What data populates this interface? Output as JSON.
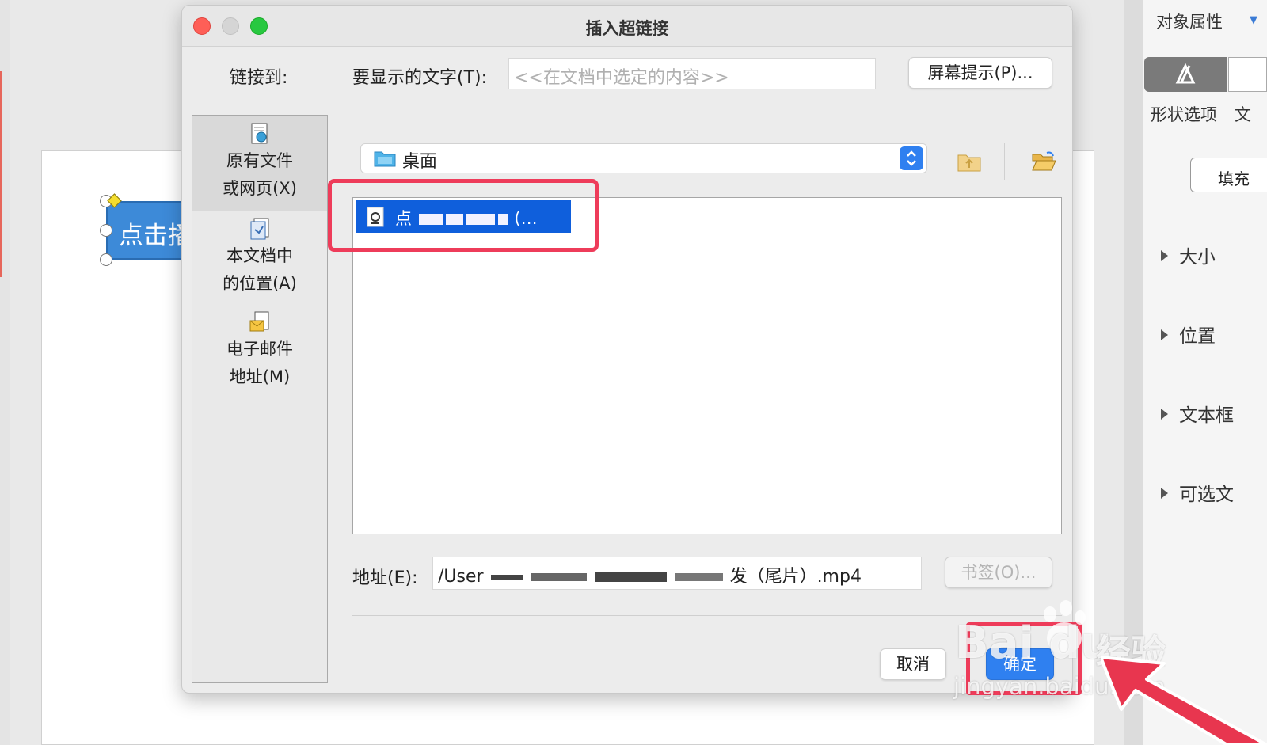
{
  "background": {
    "shape_text": "点击播"
  },
  "right_panel": {
    "title": "对象属性",
    "tabs": [
      "形状选项",
      "文"
    ],
    "fill_button": "填充",
    "sections": [
      "大小",
      "位置",
      "文本框",
      "可选文"
    ]
  },
  "dialog": {
    "title": "插入超链接",
    "link_to_label": "链接到:",
    "display_text_label": "要显示的文字(T):",
    "display_text_placeholder": "<<在文档中选定的内容>>",
    "screen_tip_button": "屏幕提示(P)...",
    "sidebar": [
      {
        "line1": "原有文件",
        "line2": "或网页(X)",
        "icon": "file-web-icon",
        "selected": true
      },
      {
        "line1": "本文档中",
        "line2": "的位置(A)",
        "icon": "document-place-icon",
        "selected": false
      },
      {
        "line1": "电子邮件",
        "line2": "地址(M)",
        "icon": "email-icon",
        "selected": false
      }
    ],
    "location": "桌面",
    "selected_file": "点",
    "selected_file_tail": "(…",
    "address_label": "地址(E):",
    "address_prefix": "/User",
    "address_suffix": "发（尾片）.mp4",
    "bookmark_button": "书签(O)...",
    "cancel_button": "取消",
    "ok_button": "确定"
  },
  "watermark": {
    "brand": "Bai",
    "brand2": "du",
    "label": "经验",
    "url": "jingyan.baidu.com"
  },
  "colors": {
    "accent": "#2f80f0",
    "selection": "#0f5fdc",
    "highlight": "#ee3c5a",
    "close": "#fe5f57",
    "zoom": "#28c840"
  }
}
